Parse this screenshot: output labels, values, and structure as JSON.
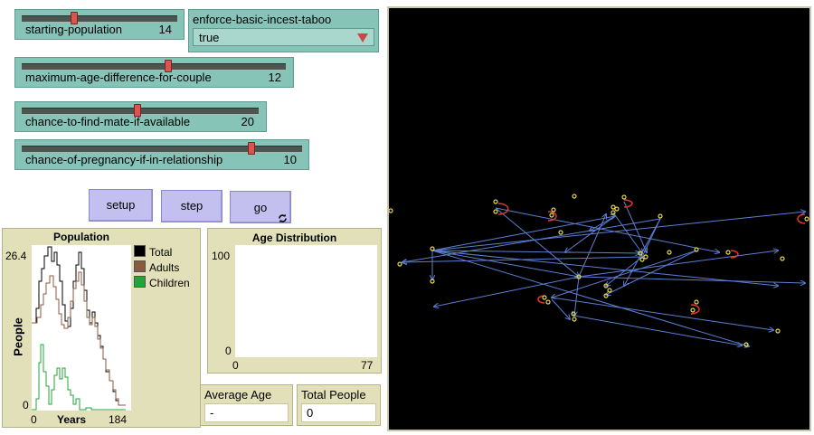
{
  "sliders": [
    {
      "label": "starting-population",
      "value": "14",
      "fraction": 0.33
    },
    {
      "label": "maximum-age-difference-for-couple",
      "value": "12",
      "fraction": 0.55
    },
    {
      "label": "chance-to-find-mate-if-available",
      "value": "20",
      "fraction": 0.48
    },
    {
      "label": "chance-of-pregnancy-if-in-relationship",
      "value": "10",
      "fraction": 0.82
    }
  ],
  "chooser": {
    "label": "enforce-basic-incest-taboo",
    "value": "true"
  },
  "buttons": {
    "setup": "setup",
    "step": "step",
    "go": "go"
  },
  "population_plot": {
    "title": "Population",
    "y_max": "26.4",
    "y_min": "0",
    "x_min": "0",
    "x_max": "184",
    "xlabel": "Years",
    "ylabel": "People",
    "legend": [
      {
        "name": "Total",
        "color": "#000000"
      },
      {
        "name": "Adults",
        "color": "#8b5a3c"
      },
      {
        "name": "Children",
        "color": "#22a43a"
      }
    ]
  },
  "age_plot": {
    "title": "Age Distribution",
    "y_max": "100",
    "y_min": "0",
    "x_min": "0",
    "x_max": "77"
  },
  "monitors": [
    {
      "label": "Average Age",
      "value": "-"
    },
    {
      "label": "Total People",
      "value": "0"
    }
  ],
  "colors": {
    "slider": "#86c4b8",
    "button": "#c3c0ef",
    "plot_panel": "#e2e0b8",
    "view_bg": "#000000",
    "link": "#5b7fd4",
    "agent": "#e6d84a",
    "marker": "#e03a2a"
  }
}
